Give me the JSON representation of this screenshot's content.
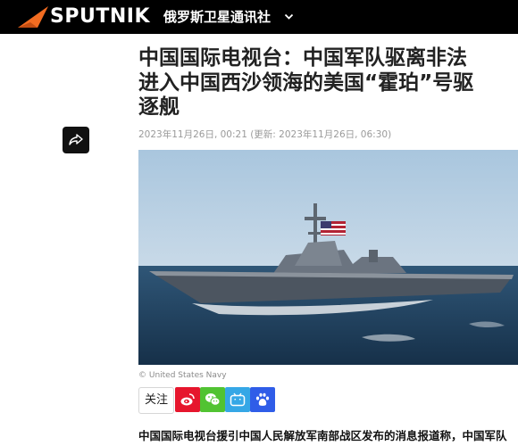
{
  "header": {
    "logo_text": "SPUTNIK",
    "site_name": "俄罗斯卫星通讯社",
    "logo_icon": "sputnik-logo-icon",
    "dropdown_icon": "chevron-down-icon",
    "colors": {
      "bar": "#000000",
      "logo_orange": "#f26c21"
    }
  },
  "article": {
    "title_lines": [
      "中国国际电视台：中国军队驱离非法",
      "进入中国西沙领海的美国“霍珀”号驱",
      "逐舰"
    ],
    "dateline": "2023年11月26日, 00:21 (更新: 2023年11月26日, 06:30)",
    "share_icon": "share-icon",
    "photo_credit": "© United States Navy",
    "follow_label": "关注",
    "social_icons": [
      "weibo-icon",
      "wechat-icon",
      "bilibili-icon",
      "baidu-icon"
    ],
    "lede": "中国国际电视台援引中国人民解放军南部战区发布的消息报道称，中国军队"
  }
}
